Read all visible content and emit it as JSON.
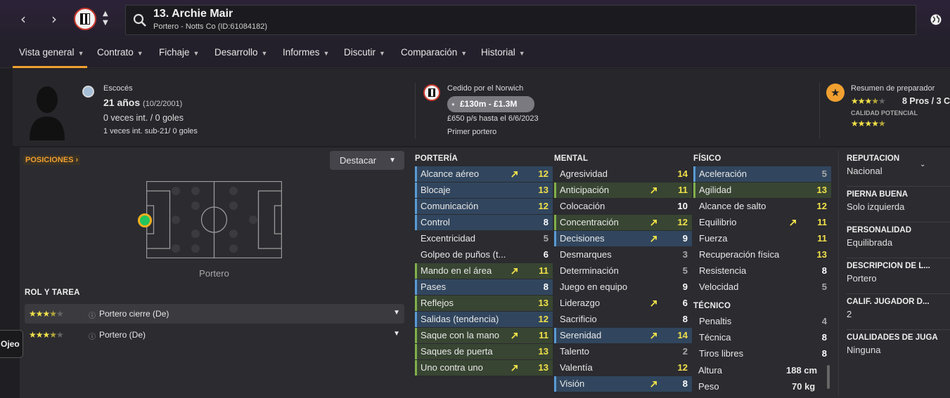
{
  "header": {
    "title": "13. Archie Mair",
    "subtitle": "Portero - Notts Co (ID:61084182)"
  },
  "tabs": [
    {
      "label": "Vista general"
    },
    {
      "label": "Contrato"
    },
    {
      "label": "Fichaje"
    },
    {
      "label": "Desarrollo"
    },
    {
      "label": "Informes"
    },
    {
      "label": "Discutir"
    },
    {
      "label": "Comparación"
    },
    {
      "label": "Historial"
    }
  ],
  "player": {
    "nationality": "Escocés",
    "age": "21 años",
    "dob": "(10/2/2001)",
    "caps": "0 veces int. / 0 goles",
    "u21": "1 veces int. sub-21/ 0 goles"
  },
  "loan": {
    "title": "Cedido por el Norwich",
    "value": "£130m - £1.3M",
    "wage": "£650 p/s hasta el 6/6/2023",
    "role": "Primer portero"
  },
  "coach": {
    "title": "Resumen de preparador",
    "pros": "8 Pros / 3 C",
    "potential_label": "CALIDAD POTENCIAL",
    "ability_stars": 3.5,
    "potential_stars": 4.5
  },
  "positions": {
    "label": "POSICIONES",
    "highlight_btn": "Destacar",
    "pitch_caption": "Portero"
  },
  "roles": {
    "heading": "ROL Y TAREA",
    "items": [
      {
        "label": "Portero cierre (De)",
        "stars": 3.5
      },
      {
        "label": "Portero (De)",
        "stars": 3.5
      }
    ]
  },
  "side_tab": "Ojeo",
  "goalkeeping": {
    "heading": "PORTERÍA",
    "attrs": [
      {
        "name": "Alcance aéreo",
        "value": "12",
        "hl": "b",
        "arrow": true
      },
      {
        "name": "Blocaje",
        "value": "13",
        "hl": "b",
        "arrow": false
      },
      {
        "name": "Comunicación",
        "value": "12",
        "hl": "b",
        "arrow": false
      },
      {
        "name": "Control",
        "value": "8",
        "hl": "b",
        "arrow": false
      },
      {
        "name": "Excentricidad",
        "value": "5",
        "hl": "",
        "arrow": false
      },
      {
        "name": "Golpeo de puños (t...",
        "value": "6",
        "hl": "",
        "arrow": false
      },
      {
        "name": "Mando en el área",
        "value": "11",
        "hl": "g",
        "arrow": true
      },
      {
        "name": "Pases",
        "value": "8",
        "hl": "b",
        "arrow": false
      },
      {
        "name": "Reflejos",
        "value": "13",
        "hl": "g",
        "arrow": false
      },
      {
        "name": "Salidas (tendencia)",
        "value": "12",
        "hl": "b",
        "arrow": false
      },
      {
        "name": "Saque con la mano",
        "value": "11",
        "hl": "g",
        "arrow": true
      },
      {
        "name": "Saques de puerta",
        "value": "13",
        "hl": "g",
        "arrow": false
      },
      {
        "name": "Uno contra uno",
        "value": "13",
        "hl": "g",
        "arrow": true
      }
    ]
  },
  "mental": {
    "heading": "MENTAL",
    "attrs": [
      {
        "name": "Agresividad",
        "value": "14",
        "hl": "",
        "arrow": false
      },
      {
        "name": "Anticipación",
        "value": "11",
        "hl": "g",
        "arrow": true
      },
      {
        "name": "Colocación",
        "value": "10",
        "hl": "",
        "arrow": false
      },
      {
        "name": "Concentración",
        "value": "12",
        "hl": "g",
        "arrow": true
      },
      {
        "name": "Decisiones",
        "value": "9",
        "hl": "b",
        "arrow": true
      },
      {
        "name": "Desmarques",
        "value": "3",
        "hl": "",
        "arrow": false
      },
      {
        "name": "Determinación",
        "value": "5",
        "hl": "",
        "arrow": false
      },
      {
        "name": "Juego en equipo",
        "value": "9",
        "hl": "",
        "arrow": false
      },
      {
        "name": "Liderazgo",
        "value": "6",
        "hl": "",
        "arrow": true
      },
      {
        "name": "Sacrificio",
        "value": "8",
        "hl": "",
        "arrow": false
      },
      {
        "name": "Serenidad",
        "value": "14",
        "hl": "b",
        "arrow": true
      },
      {
        "name": "Talento",
        "value": "2",
        "hl": "",
        "arrow": false
      },
      {
        "name": "Valentía",
        "value": "12",
        "hl": "",
        "arrow": false
      },
      {
        "name": "Visión",
        "value": "8",
        "hl": "b",
        "arrow": true
      }
    ]
  },
  "physical": {
    "heading": "FÍSICO",
    "attrs": [
      {
        "name": "Aceleración",
        "value": "5",
        "hl": "b",
        "arrow": false
      },
      {
        "name": "Agilidad",
        "value": "13",
        "hl": "g",
        "arrow": false
      },
      {
        "name": "Alcance de salto",
        "value": "12",
        "hl": "",
        "arrow": false
      },
      {
        "name": "Equilibrio",
        "value": "11",
        "hl": "",
        "arrow": true
      },
      {
        "name": "Fuerza",
        "value": "11",
        "hl": "",
        "arrow": false
      },
      {
        "name": "Recuperación física",
        "value": "13",
        "hl": "",
        "arrow": false
      },
      {
        "name": "Resistencia",
        "value": "8",
        "hl": "",
        "arrow": false
      },
      {
        "name": "Velocidad",
        "value": "5",
        "hl": "",
        "arrow": false
      }
    ]
  },
  "technical": {
    "heading": "TÉCNICO",
    "attrs": [
      {
        "name": "Penaltis",
        "value": "4",
        "hl": "",
        "arrow": false
      },
      {
        "name": "Técnica",
        "value": "8",
        "hl": "",
        "arrow": false
      },
      {
        "name": "Tiros libres",
        "value": "8",
        "hl": "",
        "arrow": false
      }
    ]
  },
  "body": {
    "height_label": "Altura",
    "height": "188 cm",
    "weight_label": "Peso",
    "weight": "70 kg"
  },
  "info": [
    {
      "title": "REPUTACIÓN",
      "value": "Nacional"
    },
    {
      "title": "PIERNA BUENA",
      "value": "Solo izquierda"
    },
    {
      "title": "PERSONALIDAD",
      "value": "Equilibrada"
    },
    {
      "title": "DESCRIPCIÓN DE L...",
      "value": "Portero"
    },
    {
      "title": "CALIF. JUGADOR D...",
      "value": "2"
    },
    {
      "title": "CUALIDADES DE JUGA",
      "value": "Ninguna"
    }
  ],
  "colors": {
    "accent": "#f0a030",
    "value_yellow": "#f2e14a",
    "dim": "#a9a9a9",
    "hl_blue": "#31465e",
    "hl_green": "#384532"
  }
}
